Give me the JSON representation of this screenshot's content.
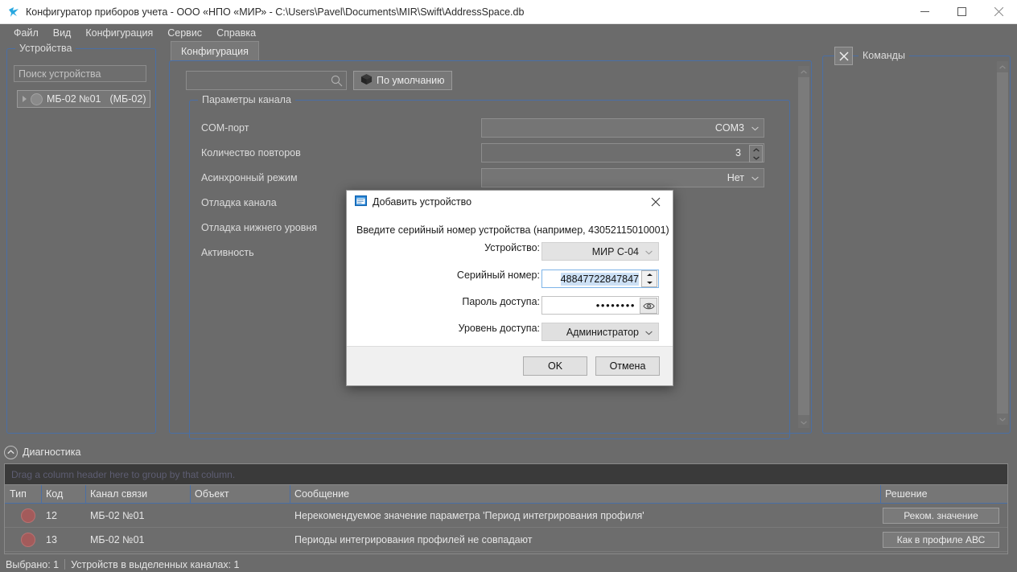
{
  "window": {
    "title": "Конфигуратор приборов учета - ООО «НПО «МИР» - C:\\Users\\Pavel\\Documents\\MIR\\Swift\\AddressSpace.db",
    "icon": "app-bird-icon",
    "minimize": "—",
    "maximize": "□",
    "close": "✕"
  },
  "menu": {
    "items": [
      {
        "label": "Файл"
      },
      {
        "label": "Вид"
      },
      {
        "label": "Конфигурация"
      },
      {
        "label": "Сервис"
      },
      {
        "label": "Справка"
      }
    ]
  },
  "devices": {
    "legend": "Устройства",
    "search_placeholder": "Поиск устройства",
    "tree": [
      {
        "label": "МБ-02 №01",
        "suffix": "(МБ-02)"
      }
    ]
  },
  "config": {
    "tab_label": "Конфигурация",
    "search_value": "",
    "default_button": "По умолчанию",
    "group_legend": "Параметры канала",
    "rows": [
      {
        "label": "COM-порт",
        "control": "combo",
        "value": "COM3"
      },
      {
        "label": "Количество повторов",
        "control": "spin",
        "value": "3"
      },
      {
        "label": "Асинхронный режим",
        "control": "combo",
        "value": "Нет"
      },
      {
        "label": "Отладка канала",
        "control": "none",
        "value": ""
      },
      {
        "label": "Отладка нижнего уровня",
        "control": "none",
        "value": ""
      },
      {
        "label": "Активность",
        "control": "none",
        "value": ""
      }
    ]
  },
  "commands": {
    "legend": "Команды",
    "close_icon": "✕"
  },
  "diagnostics": {
    "title": "Диагностика",
    "collapse_icon": "^",
    "group_hint": "Drag a column header here to group by that column.",
    "columns": [
      "Тип",
      "Код",
      "Канал связи",
      "Объект",
      "Сообщение",
      "Решение"
    ],
    "rows": [
      {
        "type_icon": "error-circle",
        "code": "12",
        "channel": "МБ-02 №01",
        "object": "",
        "message": "Нерекомендуемое значение параметра 'Период интегрирования профиля'",
        "solution": "Реком. значение"
      },
      {
        "type_icon": "error-circle",
        "code": "13",
        "channel": "МБ-02 №01",
        "object": "",
        "message": "Периоды интегрирования профилей не совпадают",
        "solution": "Как в профиле АВС"
      }
    ]
  },
  "statusbar": {
    "selected": "Выбрано: 1",
    "devices_in_channels": "Устройств в выделенных каналах: 1"
  },
  "dialog": {
    "title": "Добавить устройство",
    "icon": "window-blue-icon",
    "close": "✕",
    "prompt": "Введите серийный номер устройства (например, 43052115010001)",
    "fields": [
      {
        "label": "Устройство:",
        "type": "combo",
        "value": "МИР С-04"
      },
      {
        "label": "Серийный номер:",
        "type": "spin",
        "value": "48847722847847"
      },
      {
        "label": "Пароль доступа:",
        "type": "password",
        "value": "••••••••"
      },
      {
        "label": "Уровень доступа:",
        "type": "combo",
        "value": "Администратор"
      }
    ],
    "ok": "OK",
    "cancel": "Отмена"
  },
  "colors": {
    "app_bg": "#6b6b6b",
    "group_border": "#4a6fa5",
    "dialog_bg": "#ffffff",
    "selection": "#cce0f5",
    "error": "#a35b5b"
  }
}
